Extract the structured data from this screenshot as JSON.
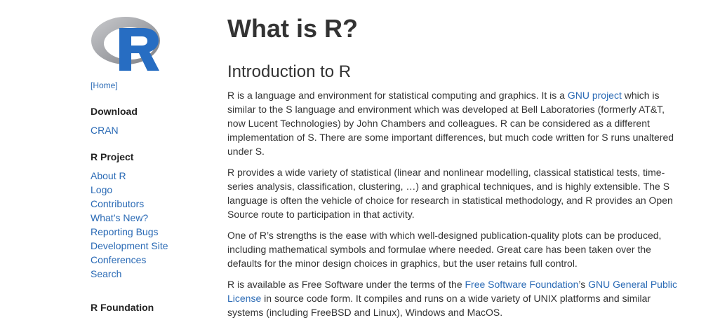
{
  "sidebar": {
    "home": "[Home]",
    "download": {
      "heading": "Download",
      "links": [
        "CRAN"
      ]
    },
    "r_project": {
      "heading": "R Project",
      "links": [
        "About R",
        "Logo",
        "Contributors",
        "What’s New?",
        "Reporting Bugs",
        "Development Site",
        "Conferences",
        "Search"
      ]
    },
    "r_foundation": {
      "heading": "R Foundation"
    }
  },
  "main": {
    "title": "What is R?",
    "section_title": "Introduction to R",
    "p1": {
      "t1": "R is a language and environment for statistical computing and graphics. It is a ",
      "link_gnu": "GNU project",
      "t2": " which is similar to the S language and environment which was developed at Bell Laboratories (formerly AT&T, now Lucent Technologies) by John Chambers and colleagues. R can be considered as a different implementation of S. There are some important differences, but much code written for S runs unaltered under S."
    },
    "p2": "R provides a wide variety of statistical (linear and nonlinear modelling, classical statistical tests, time-series analysis, classification, clustering, …) and graphical techniques, and is highly extensible. The S language is often the vehicle of choice for research in statistical methodology, and R provides an Open Source route to participation in that activity.",
    "p3": "One of R’s strengths is the ease with which well-designed publication-quality plots can be produced, including mathematical symbols and formulae where needed. Great care has been taken over the defaults for the minor design choices in graphics, but the user retains full control.",
    "p4": {
      "t1": "R is available as Free Software under the terms of the ",
      "link_fsf": "Free Software Foundation",
      "t2": "’s ",
      "link_gpl": "GNU General Public License",
      "t3": " in source code form. It compiles and runs on a wide variety of UNIX platforms and similar systems (including FreeBSD and Linux), Windows and MacOS."
    }
  }
}
